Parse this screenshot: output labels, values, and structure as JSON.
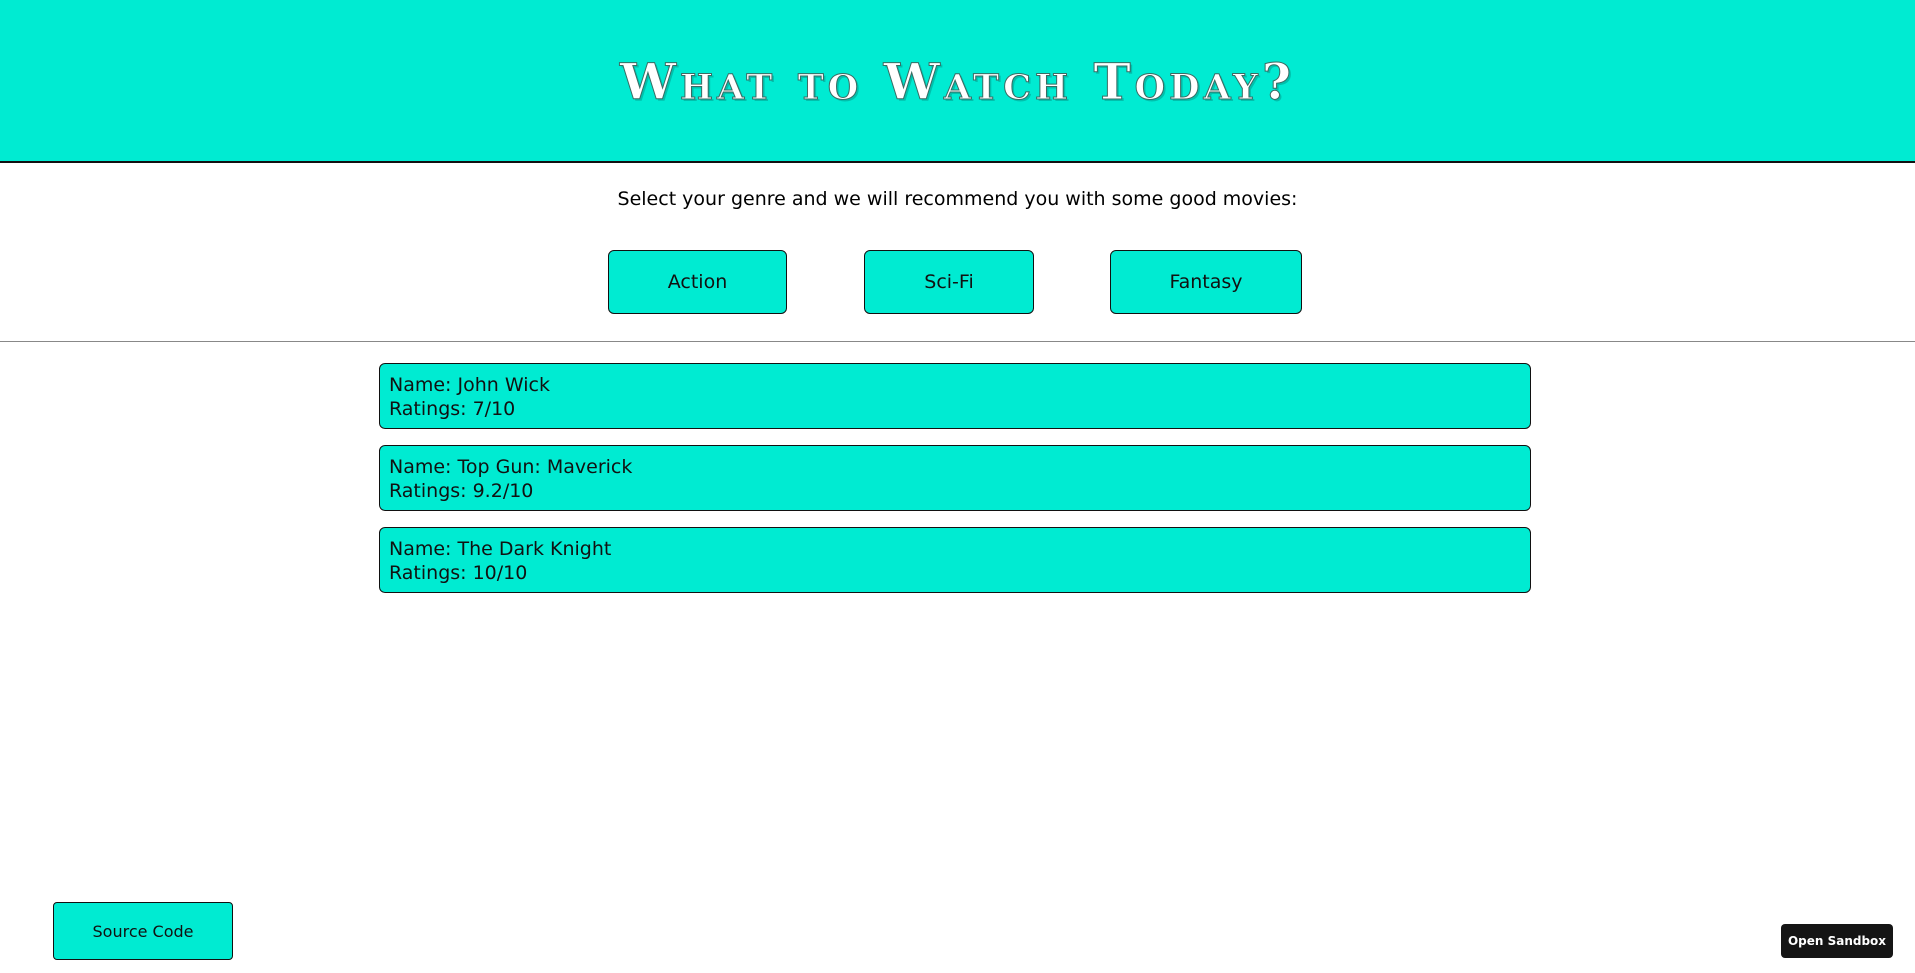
{
  "header": {
    "title": "What to Watch Today?"
  },
  "intro": {
    "subtitle": "Select your genre and we will recommend you with some good movies:"
  },
  "genres": [
    {
      "label": "Action"
    },
    {
      "label": "Sci-Fi"
    },
    {
      "label": "Fantasy"
    }
  ],
  "movies": [
    {
      "name": "Name: John Wick",
      "rating": "Ratings: 7/10"
    },
    {
      "name": "Name: Top Gun: Maverick",
      "rating": "Ratings: 9.2/10"
    },
    {
      "name": "Name: The Dark Knight",
      "rating": "Ratings: 10/10"
    }
  ],
  "footer": {
    "source_label": "Source Code",
    "sandbox_label": "Open Sandbox"
  },
  "colors": {
    "accent": "#00ebd2",
    "border": "#111111",
    "sandbox_bg": "#151515"
  }
}
